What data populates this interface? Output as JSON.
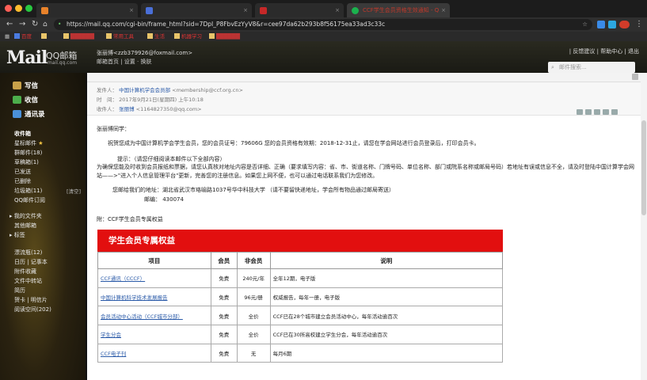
{
  "browser": {
    "tabs": [
      {
        "label": "",
        "active": false
      },
      {
        "label": "",
        "active": false
      },
      {
        "label": "",
        "active": false
      },
      {
        "label": "CCF学生会员资格生效通知 - Q",
        "active": true
      }
    ],
    "url": "https://mail.qq.com/cgi-bin/frame_html?sid=7DpI_P8FbvEzYyV8&r=cee97da62b293b8f56175ea33ad3c33c",
    "bookmarks": [
      "百度",
      "",
      "常用工具",
      "生活",
      "机器学习",
      ""
    ]
  },
  "mail_header": {
    "logo": "Mail",
    "brand": "QQ邮箱",
    "brand_url": "mail.qq.com",
    "account": "张丽博<zzb379926@foxmail.com>",
    "account_links": "邮箱首页 | 设置 · 换肤",
    "top_links": "| 反馈建议 | 帮助中心 | 退出",
    "search_placeholder": "邮件搜索..."
  },
  "sidebar": {
    "compose": "写信",
    "inbox": "收信",
    "contacts": "通讯录",
    "folders": [
      {
        "label": "收件箱",
        "header": true
      },
      {
        "label": "星标邮件",
        "star": true
      },
      {
        "label": "群邮件(18)"
      },
      {
        "label": "草稿箱(1)"
      },
      {
        "label": "已发送"
      },
      {
        "label": "已删除"
      },
      {
        "label": "垃圾箱(11)",
        "right": "[清空]"
      },
      {
        "label": "QQ邮件订阅"
      }
    ],
    "groups": [
      {
        "label": "我的文件夹"
      },
      {
        "label": "其他邮箱"
      },
      {
        "label": "标签"
      }
    ],
    "apps": [
      {
        "label": "漂流瓶(12)"
      },
      {
        "label": "日历 | 记事本"
      },
      {
        "label": "附件收藏"
      },
      {
        "label": "文件中转站"
      },
      {
        "label": "简历"
      },
      {
        "label": "贺卡 | 明信片"
      },
      {
        "label": "阅读空间(202)"
      }
    ]
  },
  "email": {
    "from_label": "发件人：",
    "from_name": "中国计算机学会会员部",
    "from_addr": "<membership@ccf.org.cn>",
    "time_label": "时　间：",
    "time": "2017年9月21日(星期四) 上午10:18",
    "to_label": "收件人：",
    "to_name": "张丽博",
    "to_addr": "<1164827350@qq.com>",
    "greeting": "张丽博同学：",
    "para1": "祝贺您成为中国计算机学会学生会员，您的会员证号：79606G   您的会员资格有效期：2018-12-31止，请您在学会网站进行会员登录后，打印会员卡。",
    "tip": "提示：（请您仔细阅读本邮件以下全部内容）",
    "para2": "为确保您能及时收到会员报纸和票据，请您认真核对地址内容是否详细、正确（要求填写内容：省、市、街道名称、门牌号码、单位名称、部门或院系名称或邮局号码）若地址有误或信息不全，请及时登陆中国计算学会网站——>\"进入个人信息管理平台\"更新，完善您的注册信息。如果您上网不便，也可以通过电话联系我们为您修改。",
    "address_line": "您邮给我们的地址：湖北省武汉市珞喻路1037号华中科技大学 （请不要留快递地址，学会所有物品通过邮局寄送）",
    "postcode_line": "邮编：  430074",
    "attachment_title": "附：CCF学生会员专属权益",
    "banner": "学生会员专属权益",
    "table_headers": [
      "项目",
      "会员",
      "非会员",
      "说明"
    ],
    "table_rows": [
      {
        "item": "CCF通讯（CCCF）",
        "member": "免费",
        "nonmember": "240元/年",
        "note": "全年12期，电子版"
      },
      {
        "item": "中国计算机科学技术发展报告",
        "member": "免费",
        "nonmember": "96元/册",
        "note": "权威报告，每年一册，电子版"
      },
      {
        "item": "会员活动中心活动（CCF城市分部）",
        "member": "免费",
        "nonmember": "全价",
        "note": "CCF已在28个城市建立会员活动中心，每年活动逾百次"
      },
      {
        "item": "学生分会",
        "member": "免费",
        "nonmember": "全价",
        "note": "CCF已在30所高校建立学生分会，每年活动逾百次"
      },
      {
        "item": "CCF电子刊",
        "member": "免费",
        "nonmember": "无",
        "note": "每月6期"
      }
    ]
  }
}
